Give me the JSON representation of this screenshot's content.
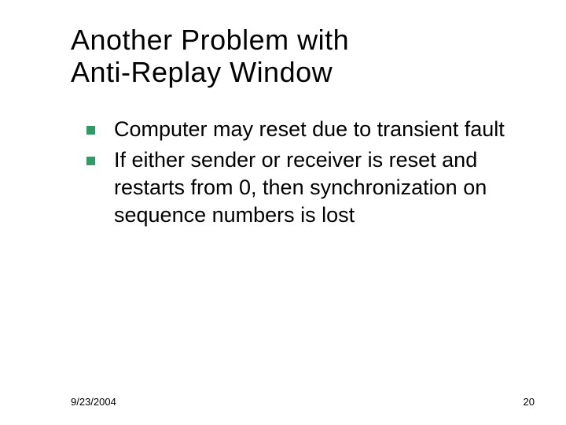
{
  "slide": {
    "title_line1": "Another Problem with",
    "title_line2": "Anti-Replay Window",
    "bullet_color": "#339966",
    "items": [
      "Computer may reset due to transient fault",
      "If either sender or receiver is reset and restarts from 0, then synchronization on sequence numbers is lost"
    ],
    "footer": {
      "date": "9/23/2004",
      "page": "20"
    }
  }
}
